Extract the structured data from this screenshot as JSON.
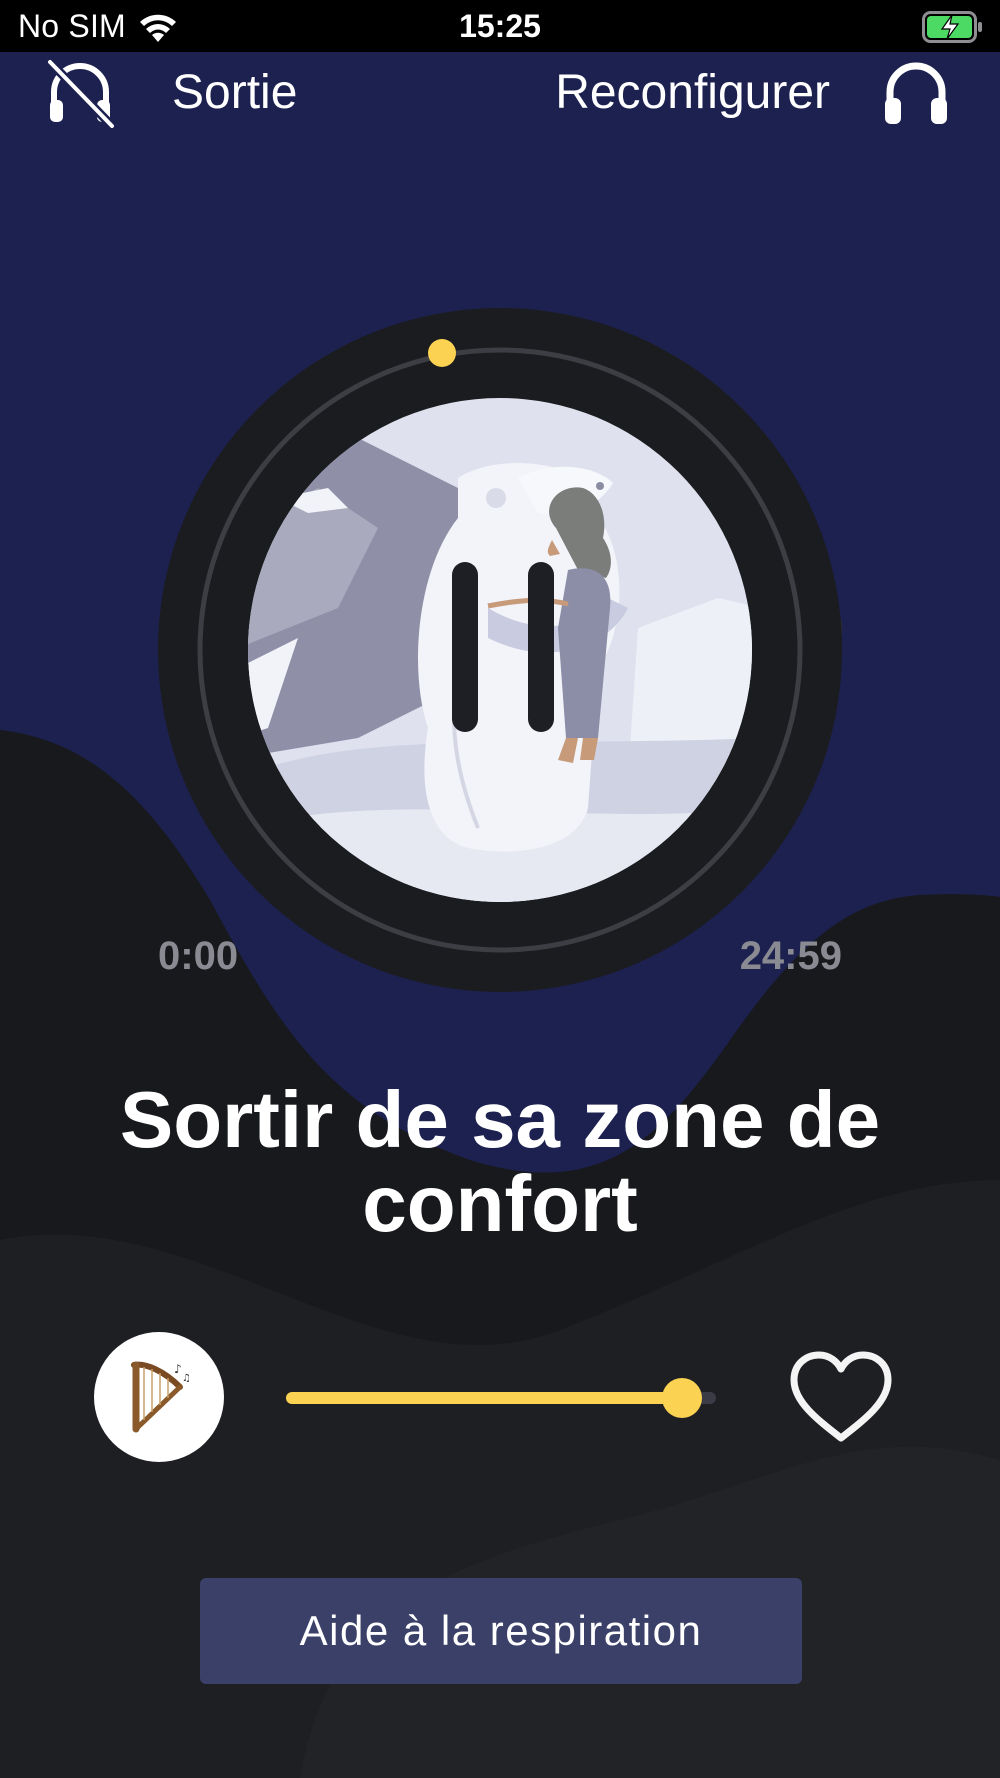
{
  "status_bar": {
    "carrier": "No SIM",
    "time": "15:25",
    "icons": [
      "wifi-icon",
      "battery-charging-icon"
    ]
  },
  "header": {
    "exit_label": "Sortie",
    "exit_icon": "headphones-off-icon",
    "reconfigure_label": "Reconfigurer",
    "reconfigure_icon": "headphones-icon"
  },
  "player": {
    "state_icon": "pause-icon",
    "elapsed": "0:00",
    "duration": "24:59",
    "progress": 0.0
  },
  "track": {
    "title": "Sortir de sa zone de confort"
  },
  "controls": {
    "ambience_icon": "harp-icon",
    "volume_level": 0.92,
    "favorite_icon": "heart-outline-icon"
  },
  "breathing_button_label": "Aide à la respiration",
  "colors": {
    "background_top": "#1d2150",
    "background_bottom": "#1b1c20",
    "accent": "#fcd253",
    "button": "#3b4068",
    "disk": "#1b1c1f"
  }
}
